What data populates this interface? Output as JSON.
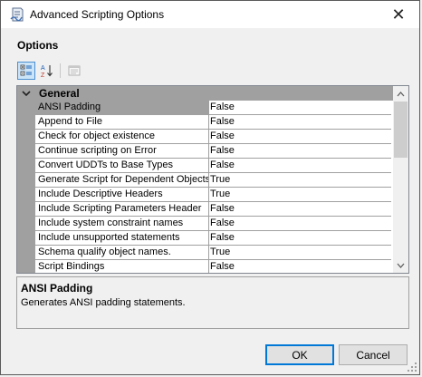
{
  "window": {
    "title": "Advanced Scripting Options",
    "close_symbol": "✕",
    "icon": "scripting-wizard-icon"
  },
  "options_label": "Options",
  "toolbar": {
    "categorized_icon": "categorized-icon",
    "alphabetical_icon": "sort-az-icon",
    "property_pages_icon": "property-pages-icon"
  },
  "grid": {
    "category": "General",
    "rows": [
      {
        "name": "ANSI Padding",
        "value": "False"
      },
      {
        "name": "Append to File",
        "value": "False"
      },
      {
        "name": "Check for object existence",
        "value": "False"
      },
      {
        "name": "Continue scripting on Error",
        "value": "False"
      },
      {
        "name": "Convert UDDTs to Base Types",
        "value": "False"
      },
      {
        "name": "Generate Script for Dependent Objects",
        "value": "True"
      },
      {
        "name": "Include Descriptive Headers",
        "value": "True"
      },
      {
        "name": "Include Scripting Parameters Header",
        "value": "False"
      },
      {
        "name": "Include system constraint names",
        "value": "False"
      },
      {
        "name": "Include unsupported statements",
        "value": "False"
      },
      {
        "name": "Schema qualify object names.",
        "value": "True"
      },
      {
        "name": "Script Bindings",
        "value": "False"
      }
    ]
  },
  "description": {
    "title": "ANSI Padding",
    "text": "Generates ANSI padding statements."
  },
  "buttons": {
    "ok": "OK",
    "cancel": "Cancel"
  },
  "colors": {
    "window_bg": "#f0f0f0",
    "grid_gutter": "#a0a0a0",
    "default_button_border": "#0078d7",
    "toolbar_active": "#cce4f7"
  }
}
